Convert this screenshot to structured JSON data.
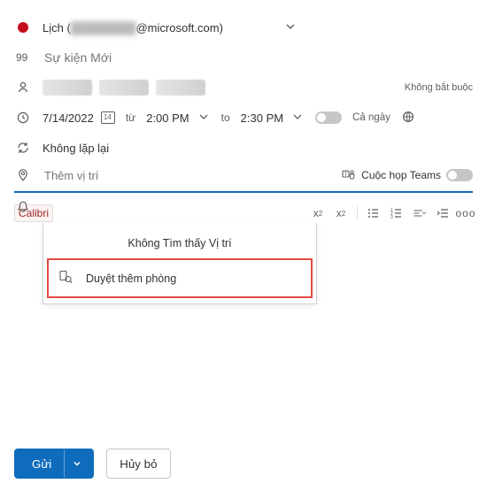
{
  "calendar": {
    "label_prefix": "Lịch (",
    "email_masked": "████████",
    "email_domain": "@microsoft.com)",
    "full_display": "Lịch (          @microsoft.com)"
  },
  "title": {
    "placeholder": "Sự kiện Mới"
  },
  "attendees": {
    "optional_label": "Không bắt buộc"
  },
  "datetime": {
    "date": "7/14/2022",
    "from_label": "từ",
    "start_time": "2:00 PM",
    "to_label": "to",
    "end_time": "2:30 PM",
    "allday_label": "Cả ngày"
  },
  "recurrence": {
    "text": "Không lặp lại"
  },
  "location": {
    "placeholder": "Thêm vị trí",
    "teams_label": "Cuộc họp Teams",
    "dropdown_title": "Không Tìm thấy Vị trí",
    "browse_rooms": "Duyệt thêm phòng"
  },
  "format_toolbar": {
    "font_name": "Calibri"
  },
  "footer": {
    "send": "Gửi",
    "cancel": "Hủy bỏ"
  }
}
